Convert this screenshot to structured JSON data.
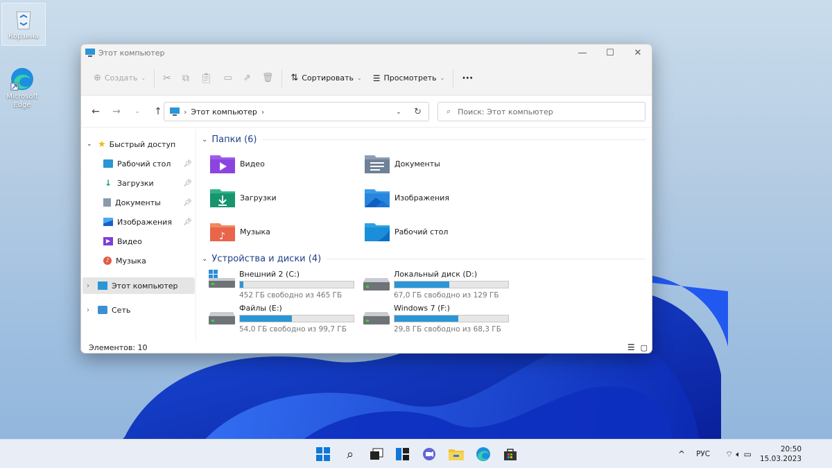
{
  "desktop": {
    "icons": [
      {
        "label": "Корзина"
      },
      {
        "label": "Microsoft Edge"
      }
    ]
  },
  "window": {
    "title": "Этот компьютер",
    "toolbar": {
      "create_label": "Создать",
      "sort_label": "Сортировать",
      "view_label": "Просмотреть",
      "more_label": "···"
    },
    "address": {
      "path": "Этот компьютер"
    },
    "search": {
      "placeholder": "Поиск: Этот компьютер"
    },
    "sidebar": {
      "quick_access": "Быстрый доступ",
      "items": [
        {
          "label": "Рабочий стол",
          "pinned": true,
          "icon": "desktop-icon"
        },
        {
          "label": "Загрузки",
          "pinned": true,
          "icon": "download-icon"
        },
        {
          "label": "Документы",
          "pinned": true,
          "icon": "documents-icon"
        },
        {
          "label": "Изображения",
          "pinned": true,
          "icon": "pictures-icon"
        },
        {
          "label": "Видео",
          "pinned": false,
          "icon": "video-icon"
        },
        {
          "label": "Музыка",
          "pinned": false,
          "icon": "music-icon"
        }
      ],
      "this_pc": "Этот компьютер",
      "network": "Сеть"
    },
    "folders_header": "Папки (6)",
    "folders": [
      {
        "label": "Видео",
        "icon": "video-folder-icon"
      },
      {
        "label": "Документы",
        "icon": "documents-folder-icon"
      },
      {
        "label": "Загрузки",
        "icon": "downloads-folder-icon"
      },
      {
        "label": "Изображения",
        "icon": "pictures-folder-icon"
      },
      {
        "label": "Музыка",
        "icon": "music-folder-icon"
      },
      {
        "label": "Рабочий стол",
        "icon": "desktop-folder-icon"
      }
    ],
    "drives_header": "Устройства и диски (4)",
    "drives": [
      {
        "name": "Внешний 2 (C:)",
        "free": "452 ГБ свободно из 465 ГБ",
        "used_fraction": 0.028
      },
      {
        "name": "Локальный диск (D:)",
        "free": "67,0 ГБ свободно из 129 ГБ",
        "used_fraction": 0.48
      },
      {
        "name": "Файлы (E:)",
        "free": "54,0 ГБ свободно из 99,7 ГБ",
        "used_fraction": 0.458
      },
      {
        "name": "Windows 7 (F:)",
        "free": "29,8 ГБ свободно из 68,3 ГБ",
        "used_fraction": 0.564
      }
    ],
    "status": "Элементов: 10"
  },
  "taskbar": {
    "lang": "РУС",
    "time": "20:50",
    "date": "15.03.2023"
  },
  "colors": {
    "accent": "#2b96d6",
    "group_header": "#1f3e8a",
    "taskbar": "#e9eef6"
  }
}
